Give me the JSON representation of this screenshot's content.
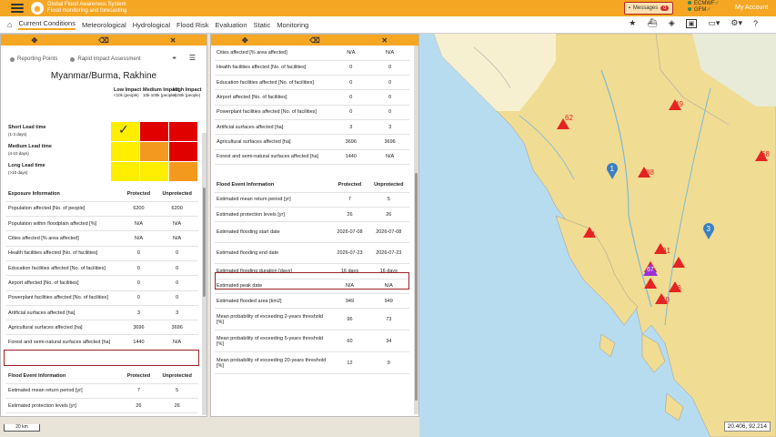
{
  "header": {
    "title_line1": "Global Flood Awareness System",
    "title_line2": "Flood monitoring and forecasting",
    "messages_label": "Messages",
    "messages_count": "0",
    "ecmwf_label": "ECMWF",
    "gfm_label": "GFM",
    "account_label": "My Account"
  },
  "nav": {
    "items": [
      "Current Conditions",
      "Meteorological",
      "Hydrological",
      "Flood Risk",
      "Evaluation",
      "Static",
      "Monitoring"
    ],
    "active_index": 0
  },
  "left_panel": {
    "tabs": [
      "Reporting Points",
      "Rapid Impact Assessment"
    ],
    "active_tab": 1,
    "region": "Myanmar/Burma, Rakhine",
    "matrix": {
      "columns": [
        {
          "title": "Low Impact",
          "sub": "<10k (people)"
        },
        {
          "title": "Medium Impact",
          "sub": "10k-100k (people)"
        },
        {
          "title": "High Impact",
          "sub": ">100k (people)"
        }
      ],
      "rows": [
        {
          "title": "Short Lead time",
          "sub": "(1-3 days)"
        },
        {
          "title": "Medium Lead time",
          "sub": "(4-10 days)"
        },
        {
          "title": "Long Lead time",
          "sub": "(>10 days)"
        }
      ],
      "check_mark": "✓",
      "colors": [
        [
          "#ffee00",
          "#e00000",
          "#e00000"
        ],
        [
          "#ffee00",
          "#f39a1e",
          "#e00000"
        ],
        [
          "#ffee00",
          "#ffee00",
          "#f39a1e"
        ]
      ]
    },
    "exposure": {
      "header": [
        "Exposure Information",
        "Protected",
        "Unprotected"
      ],
      "rows": [
        [
          "Population affected [No. of people]",
          "6200",
          "6200"
        ],
        [
          "Population within floodplain affected [%]",
          "N/A",
          "N/A"
        ],
        [
          "Cities affected [% area affected]",
          "N/A",
          "N/A"
        ],
        [
          "Health facilities affected [No. of facilities]",
          "0",
          "0"
        ],
        [
          "Education facilities affected [No. of facilities]",
          "0",
          "0"
        ],
        [
          "Airport affected [No. of facilities]",
          "0",
          "0"
        ],
        [
          "Powerplant facilities affected [No. of facilities]",
          "0",
          "0"
        ],
        [
          "Artificial surfaces affected [ha]",
          "3",
          "3"
        ],
        [
          "Agricultural surfaces affected [ha]",
          "3696",
          "3696"
        ],
        [
          "Forest and semi-natural surfaces affected [ha]",
          "1440",
          "N/A"
        ]
      ]
    },
    "flood_event": {
      "header": [
        "Flood Event Information",
        "Protected",
        "Unprotected"
      ],
      "rows": [
        [
          "Estimated mean return period [yr]",
          "7",
          "5"
        ],
        [
          "Estimated protection levels [yr]",
          "26",
          "26"
        ]
      ]
    }
  },
  "right_panel": {
    "exposure_rows": [
      [
        "Cities affected [% area affected]",
        "N/A",
        "N/A"
      ],
      [
        "Health facilities affected [No. of facilities]",
        "0",
        "0"
      ],
      [
        "Education facilities affected [No. of facilities]",
        "0",
        "0"
      ],
      [
        "Airport affected [No. of facilities]",
        "0",
        "0"
      ],
      [
        "Powerplant facilities affected [No. of facilities]",
        "0",
        "0"
      ],
      [
        "Artificial surfaces affected [ha]",
        "3",
        "3"
      ],
      [
        "Agricultural surfaces affected [ha]",
        "3696",
        "3696"
      ],
      [
        "Forest and semi-natural surfaces affected [ha]",
        "1440",
        "N/A"
      ]
    ],
    "flood_event": {
      "header": [
        "Flood Event Information",
        "Protected",
        "Unprotected"
      ],
      "rows": [
        [
          "Estimated mean return period [yr]",
          "7",
          "5"
        ],
        [
          "Estimated protection levels [yr]",
          "26",
          "26"
        ],
        [
          "Estimated flooding start date",
          "2026-07-08",
          "2026-07-08"
        ],
        [
          "Estimated flooding end date",
          "2026-07-23",
          "2026-07-23"
        ],
        [
          "Estimated flooding duration [days]",
          "16 days",
          "16 days"
        ],
        [
          "Estimated peak date",
          "N/A",
          "N/A"
        ],
        [
          "Estimated flooded area [km2]",
          "949",
          "949"
        ],
        [
          "Mean probability of exceeding 2-years threshold [%]",
          "96",
          "73"
        ],
        [
          "Mean probability of exceeding 5-years threshold [%]",
          "60",
          "34"
        ],
        [
          "Mean probability of exceeding 20-years threshold [%]",
          "12",
          "9"
        ]
      ]
    }
  },
  "map": {
    "coord": "20.406, 92.214",
    "scale": "20 km",
    "markers": [
      "62",
      "49",
      "68",
      "88",
      "84",
      "31",
      "76",
      "60",
      "67"
    ],
    "clusters": [
      "1",
      "3"
    ]
  }
}
